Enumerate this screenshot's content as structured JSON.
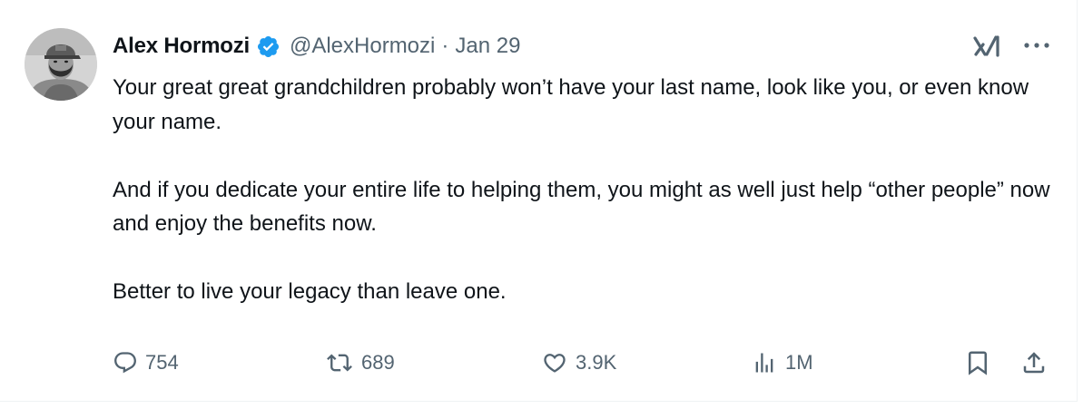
{
  "author": {
    "name": "Alex Hormozi",
    "handle": "@AlexHormozi",
    "separator": "·",
    "date": "Jan 29"
  },
  "tweet": {
    "paragraphs": [
      "Your great great grandchildren probably won’t have your last name, look like you, or even know your name.",
      "And if you dedicate your entire life to helping them, you might as well just help “other people” now and enjoy the benefits now.",
      "Better to live your legacy than leave one."
    ]
  },
  "actions": {
    "reply_count": "754",
    "repost_count": "689",
    "like_count": "3.9K",
    "view_count": "1M"
  },
  "icons": {
    "verified": "verified-badge-icon",
    "grok": "grok-icon",
    "more": "more-icon",
    "reply": "reply-icon",
    "repost": "repost-icon",
    "like": "heart-icon",
    "views": "analytics-icon",
    "bookmark": "bookmark-icon",
    "share": "share-icon"
  },
  "colors": {
    "text": "#0f1419",
    "secondary": "#536471",
    "verified": "#1d9bf0"
  }
}
